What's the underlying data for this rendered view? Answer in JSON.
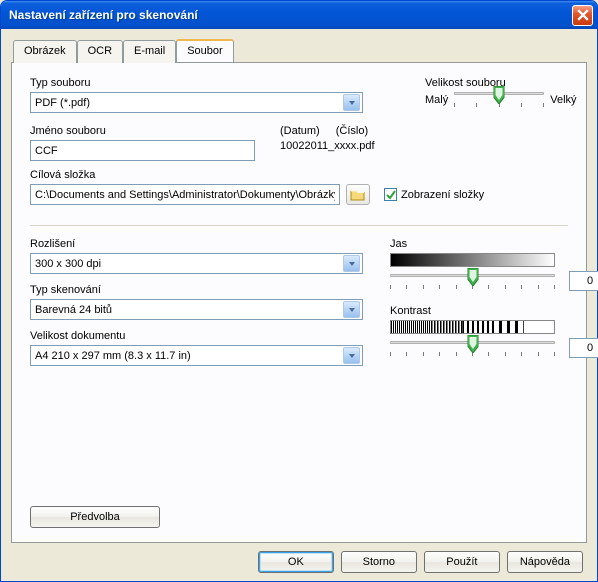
{
  "window": {
    "title": "Nastavení zařízení pro skenování"
  },
  "tabs": {
    "obrazek": "Obrázek",
    "ocr": "OCR",
    "email": "E-mail",
    "soubor": "Soubor"
  },
  "file": {
    "type_label": "Typ souboru",
    "type_value": "PDF (*.pdf)",
    "size_label": "Velikost souboru",
    "size_min": "Malý",
    "size_max": "Velký",
    "name_label": "Jméno souboru",
    "name_value": "CCF",
    "date_label": "(Datum)",
    "number_label": "(Číslo)",
    "name_pattern": "10022011_xxxx.pdf",
    "dest_label": "Cílová složka",
    "dest_value": "C:\\Documents and Settings\\Administrator\\Dokumenty\\Obrázky\\",
    "show_folder_label": "Zobrazení složky"
  },
  "scan": {
    "resolution_label": "Rozlišení",
    "resolution_value": "300 x 300 dpi",
    "scantype_label": "Typ skenování",
    "scantype_value": "Barevná 24 bitů",
    "docsize_label": "Velikost dokumentu",
    "docsize_value": "A4 210 x 297 mm (8.3 x 11.7 in)",
    "brightness_label": "Jas",
    "brightness_value": "0",
    "contrast_label": "Kontrast",
    "contrast_value": "0"
  },
  "buttons": {
    "predvolba": "Předvolba",
    "ok": "OK",
    "storno": "Storno",
    "pouzit": "Použít",
    "napoveda": "Nápověda"
  }
}
